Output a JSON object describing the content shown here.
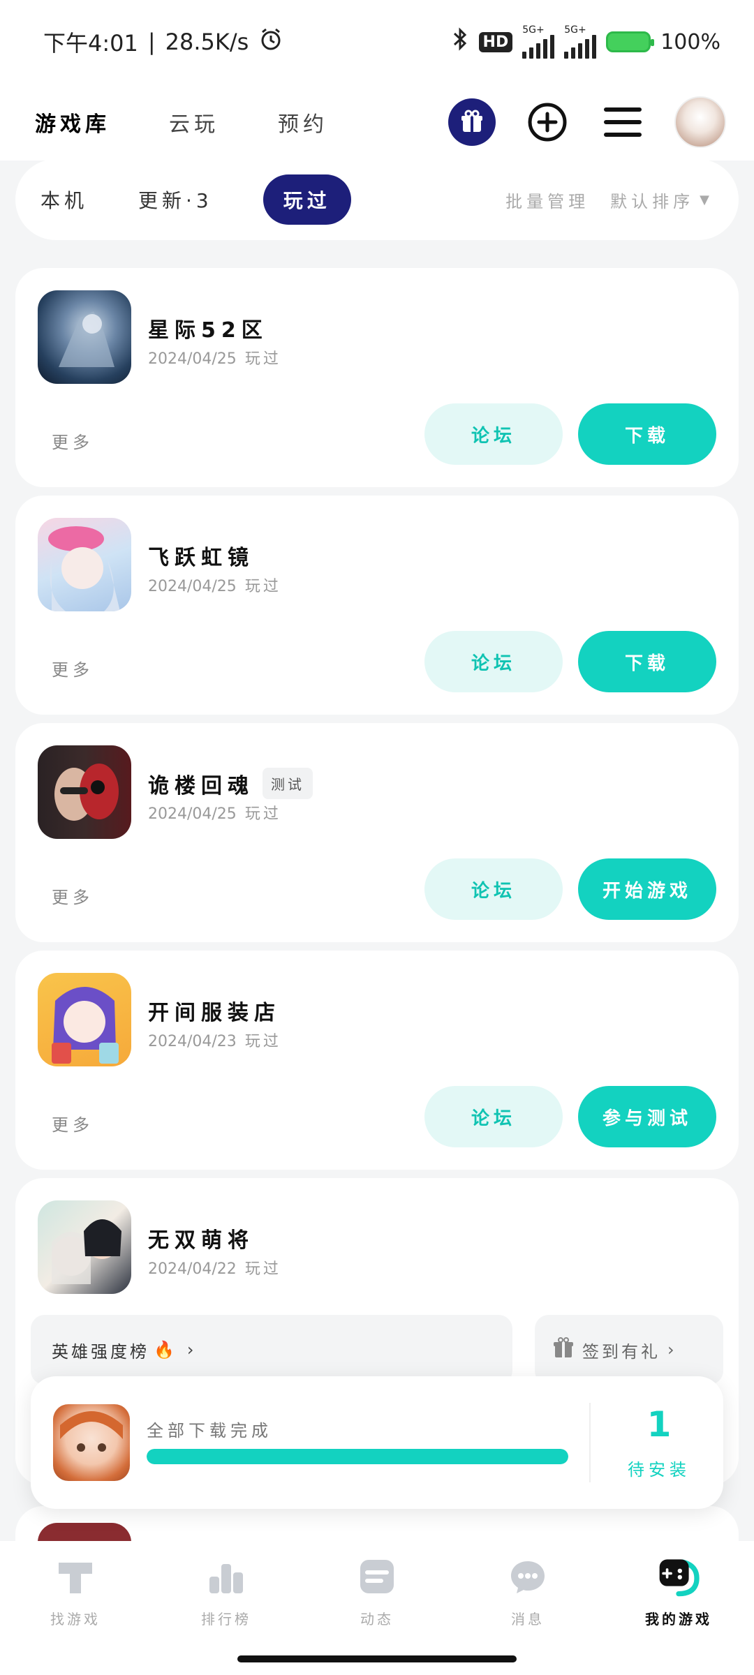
{
  "status_bar": {
    "time": "下午4:01",
    "speed": "28.5K/s",
    "network_hd": "HD",
    "network_1": "5G+",
    "network_2": "5G+",
    "battery": "100%"
  },
  "header": {
    "tabs": [
      {
        "label": "游戏库",
        "active": true
      },
      {
        "label": "云玩",
        "active": false
      },
      {
        "label": "预约",
        "active": false
      }
    ],
    "icons": [
      "gift-icon",
      "plus-circle-icon",
      "menu-icon",
      "avatar"
    ]
  },
  "filter": {
    "local": "本机",
    "update": "更新·3",
    "played": "玩过",
    "batch": "批量管理",
    "sort": "默认排序"
  },
  "games": [
    {
      "name": "星际52区",
      "date": "2024/04/25",
      "tag": "玩过",
      "more": "更多",
      "forum": "论坛",
      "action": "下载",
      "badge": ""
    },
    {
      "name": "飞跃虹镜",
      "date": "2024/04/25",
      "tag": "玩过",
      "more": "更多",
      "forum": "论坛",
      "action": "下载",
      "badge": ""
    },
    {
      "name": "诡楼回魂",
      "date": "2024/04/25",
      "tag": "玩过",
      "more": "更多",
      "forum": "论坛",
      "action": "开始游戏",
      "badge": "测试"
    },
    {
      "name": "开间服装店",
      "date": "2024/04/23",
      "tag": "玩过",
      "more": "更多",
      "forum": "论坛",
      "action": "参与测试",
      "badge": ""
    },
    {
      "name": "无双萌将",
      "date": "2024/04/22",
      "tag": "玩过",
      "promo_left": "英雄强度榜",
      "promo_right": "签到有礼"
    }
  ],
  "download_panel": {
    "text": "全部下载完成",
    "progress": 1.0,
    "count": "1",
    "label": "待安装"
  },
  "bottom_nav": [
    {
      "label": "找游戏",
      "icon": "find-game-icon",
      "active": false
    },
    {
      "label": "排行榜",
      "icon": "ranking-icon",
      "active": false
    },
    {
      "label": "动态",
      "icon": "feed-icon",
      "active": false
    },
    {
      "label": "消息",
      "icon": "message-icon",
      "active": false
    },
    {
      "label": "我的游戏",
      "icon": "my-games-icon",
      "active": true
    }
  ],
  "colors": {
    "accent": "#13d2c0",
    "navy": "#1d1f7a"
  }
}
